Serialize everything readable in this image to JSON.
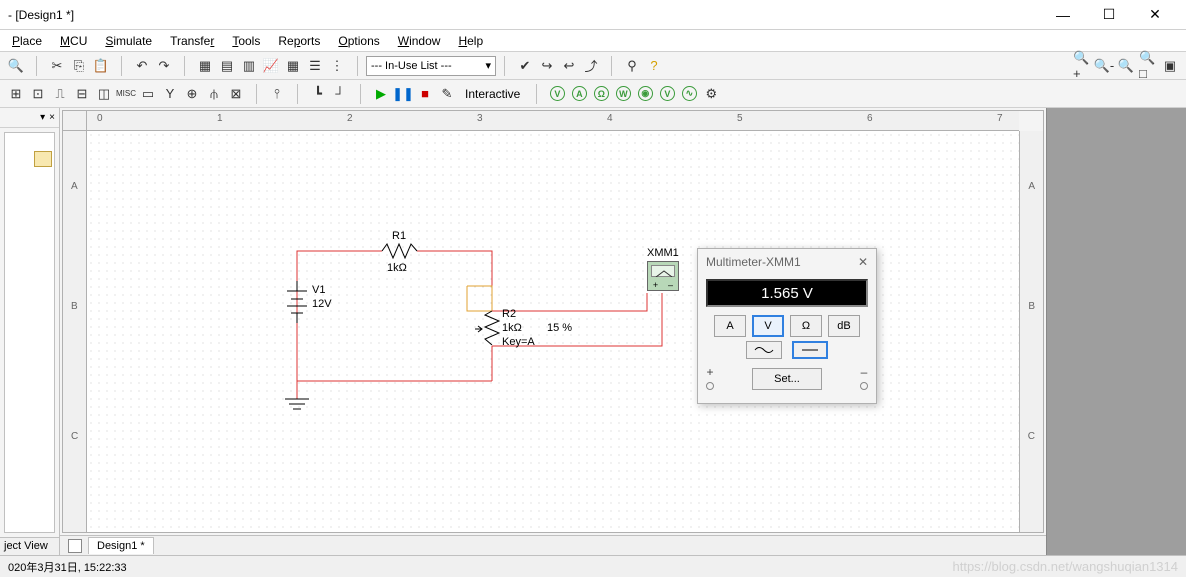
{
  "window": {
    "title": "- [Design1 *]",
    "min": "—",
    "max": "☐",
    "close": "✕"
  },
  "menu": {
    "items": [
      "Place",
      "MCU",
      "Simulate",
      "Transfer",
      "Tools",
      "Reports",
      "Options",
      "Window",
      "Help"
    ]
  },
  "toolbar1": {
    "inuse_dropdown": "--- In-Use List ---",
    "zoom_icons": [
      "zoom-in",
      "zoom-out",
      "zoom",
      "zoom-all",
      "zoom-sheet"
    ]
  },
  "toolbar2": {
    "sim_mode": "Interactive"
  },
  "leftpanel": {
    "close": "×",
    "tab": "ject View"
  },
  "ruler_h": {
    "t0": "0",
    "t1": "1",
    "t2": "2",
    "t3": "3",
    "t4": "4",
    "t5": "5",
    "t6": "6",
    "t7": "7"
  },
  "ruler_v": {
    "a": "A",
    "b": "B",
    "c": "C"
  },
  "circuit": {
    "v1_name": "V1",
    "v1_val": "12V",
    "r1_name": "R1",
    "r1_val": "1kΩ",
    "r2_name": "R2",
    "r2_val": "1kΩ",
    "r2_key": "Key=A",
    "r2_pct": "15 %",
    "xmm_name": "XMM1"
  },
  "mm": {
    "title": "Multimeter-XMM1",
    "close": "✕",
    "readout": "1.565 V",
    "btn_a": "A",
    "btn_v": "V",
    "btn_ohm": "Ω",
    "btn_db": "dB",
    "set": "Set...",
    "term_plus": "+",
    "term_minus": "–"
  },
  "tabs": {
    "design1": "Design1 *"
  },
  "status": {
    "datetime": "020年3月31日, 15:22:33",
    "watermark": "https://blog.csdn.net/wangshuqian1314"
  }
}
